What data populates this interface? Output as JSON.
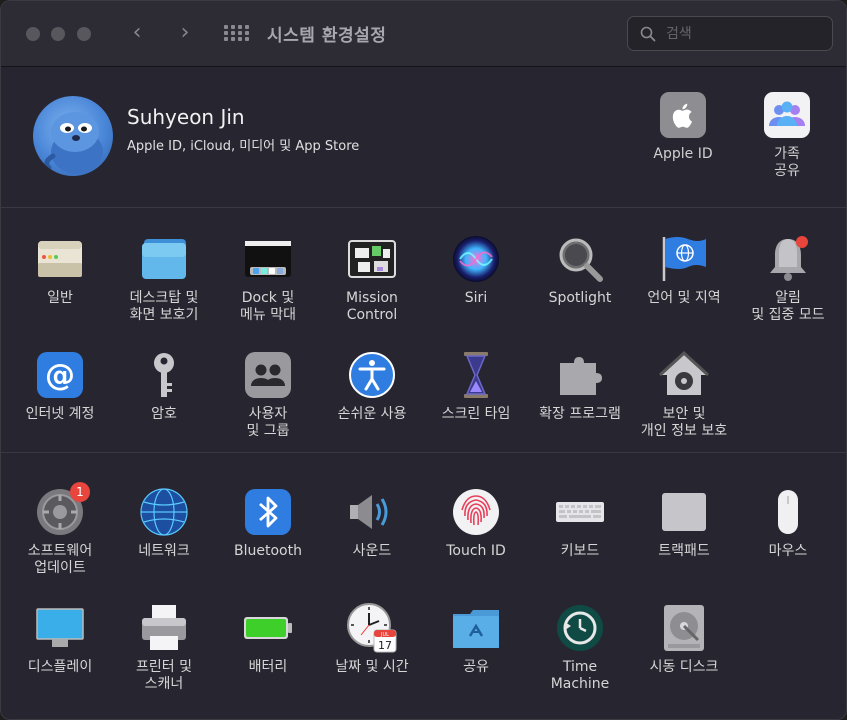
{
  "window": {
    "title": "시스템 환경설정",
    "back_glyph": "‹",
    "forward_glyph": "›"
  },
  "search": {
    "placeholder": "검색",
    "value": ""
  },
  "account": {
    "name": "Suhyeon Jin",
    "subtitle": "Apple ID, iCloud, 미디어 및 App Store",
    "items": [
      {
        "label": "Apple ID",
        "icon": "apple-id-icon"
      },
      {
        "label": "가족\n공유",
        "icon": "family-sharing-icon"
      }
    ]
  },
  "prefs_row1": [
    {
      "label": "일반",
      "icon": "general-icon"
    },
    {
      "label": "데스크탑 및\n화면 보호기",
      "icon": "desktop-screensaver-icon"
    },
    {
      "label": "Dock 및\n메뉴 막대",
      "icon": "dock-menubar-icon"
    },
    {
      "label": "Mission\nControl",
      "icon": "mission-control-icon"
    },
    {
      "label": "Siri",
      "icon": "siri-icon"
    },
    {
      "label": "Spotlight",
      "icon": "spotlight-icon"
    },
    {
      "label": "언어 및 지역",
      "icon": "language-region-icon"
    },
    {
      "label": "알림\n및 집중 모드",
      "icon": "notifications-icon"
    }
  ],
  "prefs_row2": [
    {
      "label": "인터넷 계정",
      "icon": "internet-accounts-icon"
    },
    {
      "label": "암호",
      "icon": "passwords-icon"
    },
    {
      "label": "사용자\n및 그룹",
      "icon": "users-groups-icon"
    },
    {
      "label": "손쉬운 사용",
      "icon": "accessibility-icon"
    },
    {
      "label": "스크린 타임",
      "icon": "screen-time-icon"
    },
    {
      "label": "확장 프로그램",
      "icon": "extensions-icon"
    },
    {
      "label": "보안 및\n개인 정보 보호",
      "icon": "security-privacy-icon"
    }
  ],
  "prefs_row3": [
    {
      "label": "소프트웨어\n업데이트",
      "icon": "software-update-icon",
      "badge": "1"
    },
    {
      "label": "네트워크",
      "icon": "network-icon"
    },
    {
      "label": "Bluetooth",
      "icon": "bluetooth-icon"
    },
    {
      "label": "사운드",
      "icon": "sound-icon"
    },
    {
      "label": "Touch ID",
      "icon": "touch-id-icon"
    },
    {
      "label": "키보드",
      "icon": "keyboard-icon"
    },
    {
      "label": "트랙패드",
      "icon": "trackpad-icon"
    },
    {
      "label": "마우스",
      "icon": "mouse-icon"
    }
  ],
  "prefs_row4": [
    {
      "label": "디스플레이",
      "icon": "displays-icon"
    },
    {
      "label": "프린터 및\n스캐너",
      "icon": "printers-scanners-icon"
    },
    {
      "label": "배터리",
      "icon": "battery-icon"
    },
    {
      "label": "날짜 및 시간",
      "icon": "date-time-icon",
      "calendar_month": "JUL",
      "calendar_day": "17"
    },
    {
      "label": "공유",
      "icon": "sharing-icon"
    },
    {
      "label": "Time\nMachine",
      "icon": "time-machine-icon"
    },
    {
      "label": "시동 디스크",
      "icon": "startup-disk-icon"
    }
  ],
  "colors": {
    "window_bg": "#272530",
    "titlebar_bg": "#2d2b33",
    "badge_red": "#e8453c",
    "accent_blue": "#2f7de1"
  }
}
